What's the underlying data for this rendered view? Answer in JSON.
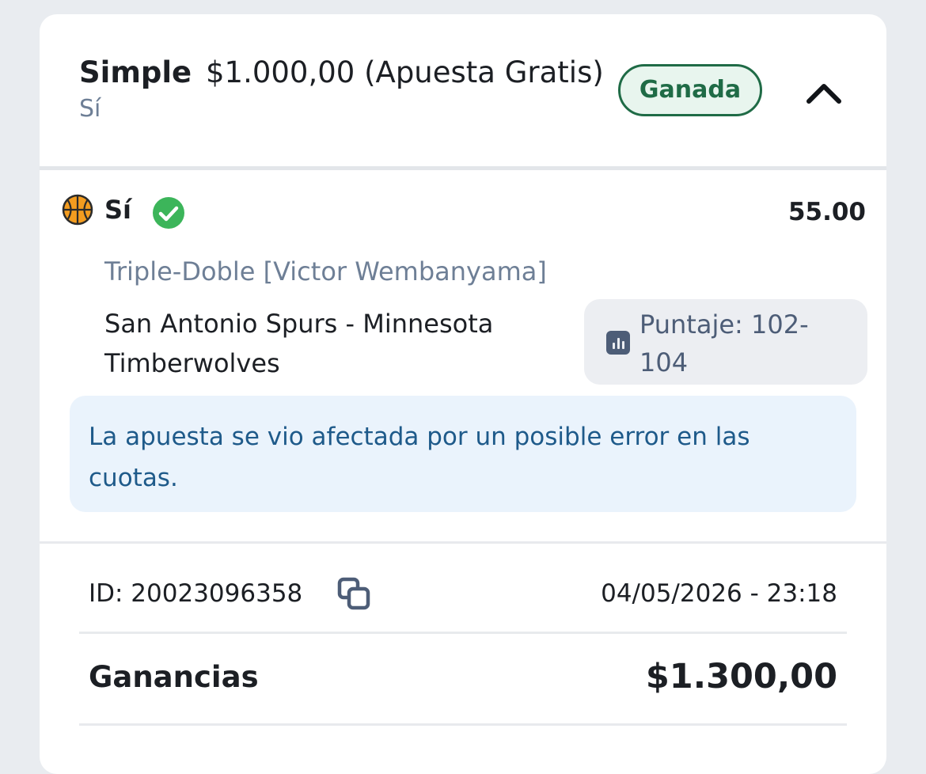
{
  "bet": {
    "type": "Simple",
    "amount": "$1.000,00 (Apuesta Gratis)",
    "selection_summary": "Sí",
    "status": "Ganada",
    "colors": {
      "status_text": "#1f6b46",
      "status_bg": "#e8f5ee",
      "accent": "#4caf50"
    }
  },
  "selection": {
    "sport_icon": "basketball-icon",
    "name": "Sí",
    "result_icon": "check-circle-icon",
    "odds": "55.00",
    "market": "Triple-Doble [Victor Wembanyama]",
    "event": "San Antonio Spurs - Minnesota Timberwolves",
    "score_icon": "stats-chart-icon",
    "score": "Puntaje: 102-104"
  },
  "notice": {
    "text": "La apuesta se vio afectada por un posible error en las cuotas."
  },
  "details": {
    "id": "ID: 20023096358",
    "copy_icon": "copy-icon",
    "placed_at": "04/05/2026 - 23:18",
    "winnings_label": "Ganancias",
    "winnings_value": "$1.300,00"
  },
  "header": {
    "collapse_icon": "chevron-up-icon"
  }
}
